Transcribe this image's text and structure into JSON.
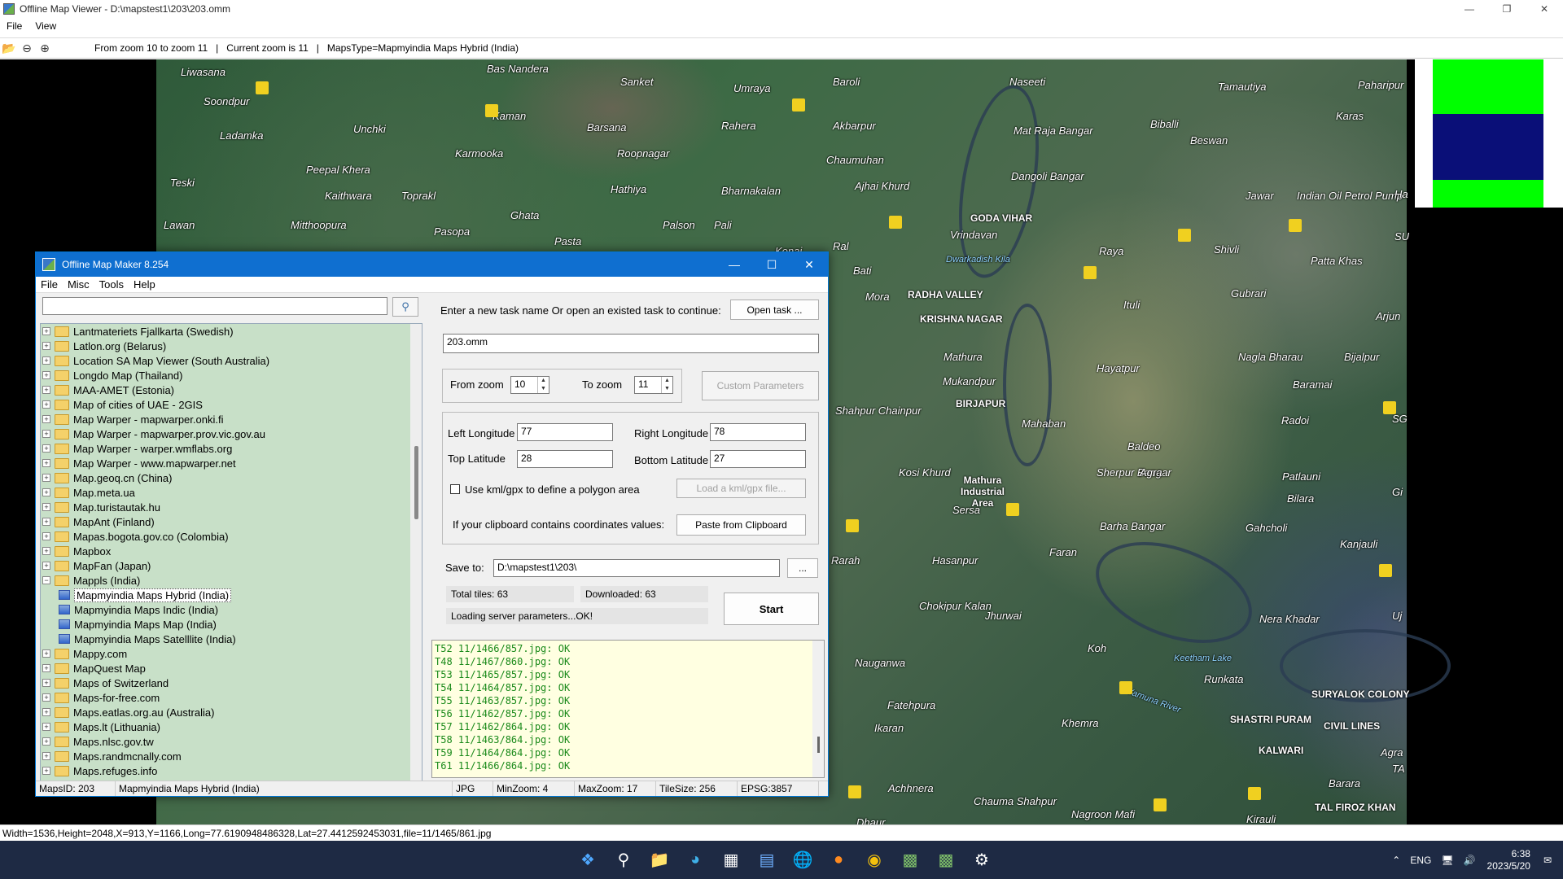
{
  "viewer": {
    "title": "Offline Map Viewer - D:\\mapstest1\\203\\203.omm",
    "menu": [
      "File",
      "View"
    ],
    "toolbar_info": [
      "From zoom 10 to zoom 11",
      "|",
      "Current zoom is 11",
      "|",
      "MapsType=Mapmyindia Maps Hybrid (India)"
    ],
    "status": "Width=1536,Height=2048,X=913,Y=1166,Long=77.6190948486328,Lat=27.4412592453031,file=11/1465/861.jpg"
  },
  "map": {
    "labels": [
      "Liwasana",
      "Bas Nandera",
      "Sanket",
      "Umraya",
      "Baroli",
      "Naseeti",
      "Tamautiya",
      "Paharipur",
      "Soondpur",
      "Kaman",
      "Barsana",
      "Rahera",
      "Akbarpur",
      "Mat Raja Bangar",
      "Biballi",
      "Beswan",
      "Karas",
      "Ladamka",
      "Unchki",
      "Karmooka",
      "Roopnagar",
      "Chaumuhan",
      "Peepal Khera",
      "Hathiya",
      "Ajhai Khurd",
      "Dangoli Bangar",
      "Teski",
      "Kaithwara",
      "Toprakl",
      "Bharnakalan",
      "Jawar",
      "Indian Oil Petrol Pump",
      "Lawan",
      "Mitthoopura",
      "Pasopa",
      "Ghata",
      "Palson",
      "Pali",
      "Vrindavan",
      "Raya",
      "Shivli",
      "Patta Khas",
      "Pasta",
      "Konai",
      "Ral",
      "Bati",
      "Gubrari",
      "Mora",
      "Ituli",
      "Mathura",
      "Nagla Bharau",
      "Hayatpur",
      "Baramai",
      "Bijalpur",
      "Mukandpur",
      "Shahpur Chainpur",
      "Mahaban",
      "Radoi",
      "Baldeo",
      "Kosi Khurd",
      "Sherpur Bangar",
      "Patlauni",
      "Bilara",
      "Sersa",
      "Barha Bangar",
      "Gahcholi",
      "Kanjauli",
      "Rarah",
      "Hasanpur",
      "Faran",
      "Chokipur Kalan",
      "Jhurwai",
      "Koh",
      "Nera Khadar",
      "Nauganwa",
      "Runkata",
      "Fatehpura",
      "Ikaran",
      "Khemra",
      "Achhnera",
      "Chauma Shahpur",
      "Dhaur",
      "Nagroon Mafi",
      "Kirauli",
      "Barara",
      "Agra"
    ],
    "bold_labels": [
      "GODA VIHAR",
      "RADHA VALLEY",
      "KRISHNA NAGAR",
      "BIRJAPUR",
      "Mathura Industrial Area",
      "SURYALOK COLONY",
      "SHASTRI PURAM",
      "CIVIL LINES",
      "KALWARI",
      "TAL FIROZ KHAN"
    ],
    "water_labels": [
      "Yamuna River",
      "Dwarkadish Kila",
      "Keetham Lake"
    ],
    "edge_labels": [
      "Ha",
      "SU",
      "Arjun",
      "SG",
      "Gi",
      "Uj",
      "TA",
      "Agra"
    ]
  },
  "dialog": {
    "title": "Offline Map Maker 8.254",
    "menu": [
      "File",
      "Misc",
      "Tools",
      "Help"
    ],
    "search_value": "",
    "tree": [
      {
        "label": "Lantmateriets Fjallkarta (Swedish)"
      },
      {
        "label": "Latlon.org (Belarus)"
      },
      {
        "label": "Location SA Map Viewer (South Australia)"
      },
      {
        "label": "Longdo Map (Thailand)"
      },
      {
        "label": "MAA-AMET (Estonia)"
      },
      {
        "label": "Map of cities of UAE - 2GIS"
      },
      {
        "label": "Map Warper - mapwarper.onki.fi"
      },
      {
        "label": "Map Warper - mapwarper.prov.vic.gov.au"
      },
      {
        "label": "Map Warper - warper.wmflabs.org"
      },
      {
        "label": "Map Warper - www.mapwarper.net"
      },
      {
        "label": "Map.geoq.cn (China)"
      },
      {
        "label": "Map.meta.ua"
      },
      {
        "label": "Map.turistautak.hu"
      },
      {
        "label": "MapAnt (Finland)"
      },
      {
        "label": "Mapas.bogota.gov.co (Colombia)"
      },
      {
        "label": "Mapbox"
      },
      {
        "label": "MapFan (Japan)"
      },
      {
        "label": "Mappls (India)",
        "expanded": true
      },
      {
        "label": "Mapmyindia Maps Hybrid (India)",
        "child": true,
        "selected": true
      },
      {
        "label": "Mapmyindia Maps Indic (India)",
        "child": true
      },
      {
        "label": "Mapmyindia Maps Map (India)",
        "child": true
      },
      {
        "label": "Mapmyindia Maps Satelllite (India)",
        "child": true
      },
      {
        "label": "Mappy.com"
      },
      {
        "label": "MapQuest Map"
      },
      {
        "label": "Maps of Switzerland"
      },
      {
        "label": "Maps-for-free.com"
      },
      {
        "label": "Maps.eatlas.org.au (Australia)"
      },
      {
        "label": "Maps.lt (Lithuania)"
      },
      {
        "label": "Maps.nlsc.gov.tw"
      },
      {
        "label": "Maps.randmcnally.com"
      },
      {
        "label": "Maps.refuges.info"
      }
    ],
    "task_prompt": "Enter a new task name Or open an existed task to continue:",
    "open_task_label": "Open task ...",
    "task_name": "203.omm",
    "from_zoom_label": "From zoom",
    "from_zoom": "10",
    "to_zoom_label": "To zoom",
    "to_zoom": "11",
    "custom_params_label": "Custom Parameters",
    "left_lon_label": "Left Longitude",
    "left_lon": "77",
    "right_lon_label": "Right Longitude",
    "right_lon": "78",
    "top_lat_label": "Top Latitude",
    "top_lat": "28",
    "bottom_lat_label": "Bottom Latitude",
    "bottom_lat": "27",
    "kml_check_label": "Use kml/gpx to define a polygon area",
    "load_kml_label": "Load a kml/gpx file...",
    "clipboard_prompt": "If your clipboard contains coordinates values:",
    "paste_label": "Paste from Clipboard",
    "save_to_label": "Save to:",
    "save_to": "D:\\mapstest1\\203\\",
    "browse_label": "...",
    "total_tiles": "Total tiles: 63",
    "downloaded": "Downloaded: 63",
    "loading_status": "Loading server parameters...OK!",
    "start_label": "Start",
    "log": [
      "T52 11/1466/857.jpg: OK",
      "T48 11/1467/860.jpg: OK",
      "T53 11/1465/857.jpg: OK",
      "T54 11/1464/857.jpg: OK",
      "T55 11/1463/857.jpg: OK",
      "T56 11/1462/857.jpg: OK",
      "T57 11/1462/864.jpg: OK",
      "T58 11/1463/864.jpg: OK",
      "T59 11/1464/864.jpg: OK",
      "T61 11/1466/864.jpg: OK"
    ],
    "status": {
      "maps_id": "MapsID: 203",
      "map_name": "Mapmyindia Maps Hybrid (India)",
      "format": "JPG",
      "min_zoom": "MinZoom: 4",
      "max_zoom": "MaxZoom: 17",
      "tile_size": "TileSize: 256",
      "epsg": "EPSG:3857"
    }
  },
  "taskbar": {
    "lang": "ENG",
    "time": "6:38",
    "date": "2023/5/20"
  }
}
